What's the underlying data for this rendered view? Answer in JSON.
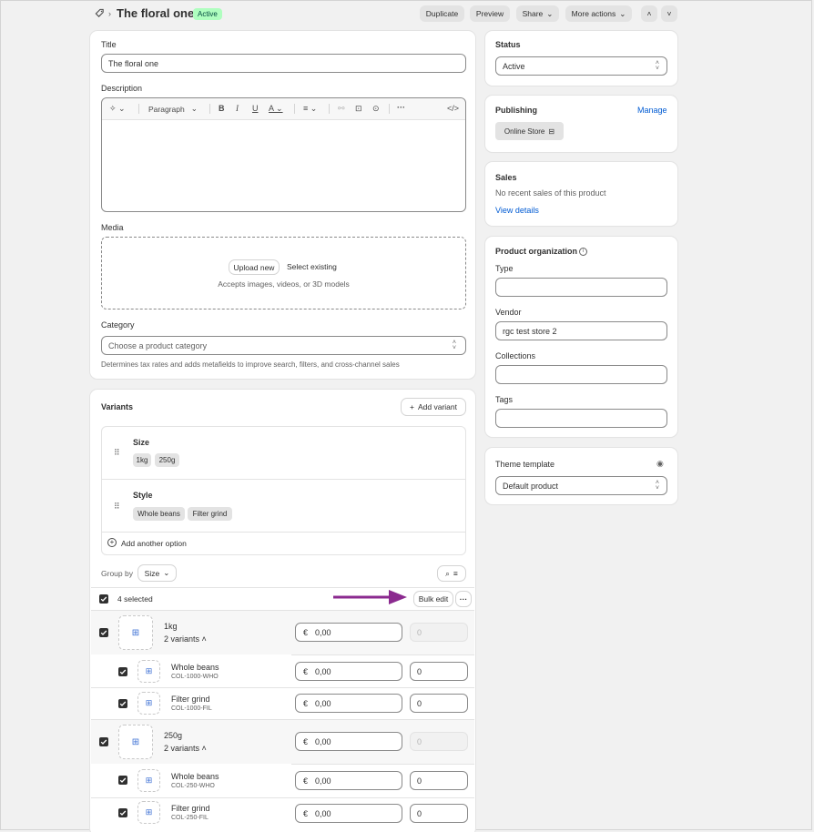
{
  "header": {
    "title": "The floral one",
    "status_badge": "Active",
    "actions": {
      "duplicate": "Duplicate",
      "preview": "Preview",
      "share": "Share",
      "more": "More actions"
    }
  },
  "main": {
    "title_label": "Title",
    "title_value": "The floral one",
    "description_label": "Description",
    "editor": {
      "format": "Paragraph"
    },
    "media_label": "Media",
    "media": {
      "upload": "Upload new",
      "select": "Select existing",
      "hint": "Accepts images, videos, or 3D models"
    },
    "category_label": "Category",
    "category_placeholder": "Choose a product category",
    "category_help": "Determines tax rates and adds metafields to improve search, filters, and cross-channel sales"
  },
  "variants": {
    "heading": "Variants",
    "add_variant": "Add variant",
    "options": [
      {
        "name": "Size",
        "values": [
          "1kg",
          "250g"
        ]
      },
      {
        "name": "Style",
        "values": [
          "Whole beans",
          "Filter grind"
        ]
      }
    ],
    "add_option": "Add another option",
    "group_by_label": "Group by",
    "group_by_value": "Size",
    "selected": "4 selected",
    "bulk_edit": "Bulk edit",
    "groups": [
      {
        "name": "1kg",
        "count": "2 variants",
        "price": "0,00",
        "qty": "0",
        "items": [
          {
            "name": "Whole beans",
            "sku": "COL-1000-WHO",
            "price": "0,00",
            "qty": "0"
          },
          {
            "name": "Filter grind",
            "sku": "COL-1000-FIL",
            "price": "0,00",
            "qty": "0"
          }
        ]
      },
      {
        "name": "250g",
        "count": "2 variants",
        "price": "0,00",
        "qty": "0",
        "items": [
          {
            "name": "Whole beans",
            "sku": "COL-250-WHO",
            "price": "0,00",
            "qty": "0"
          },
          {
            "name": "Filter grind",
            "sku": "COL-250-FIL",
            "price": "0,00",
            "qty": "0"
          }
        ]
      }
    ],
    "currency": "€"
  },
  "side": {
    "status_label": "Status",
    "status_value": "Active",
    "publishing_label": "Publishing",
    "manage": "Manage",
    "channel": "Online Store",
    "sales_label": "Sales",
    "sales_text": "No recent sales of this product",
    "view_details": "View details",
    "org_label": "Product organization",
    "type_label": "Type",
    "vendor_label": "Vendor",
    "vendor_value": "rgc test store 2",
    "collections_label": "Collections",
    "tags_label": "Tags",
    "theme_label": "Theme template",
    "theme_value": "Default product"
  },
  "colors": {
    "accent_link": "#005bd3",
    "badge_bg": "#affebf",
    "arrow": "#8b2a8f"
  }
}
